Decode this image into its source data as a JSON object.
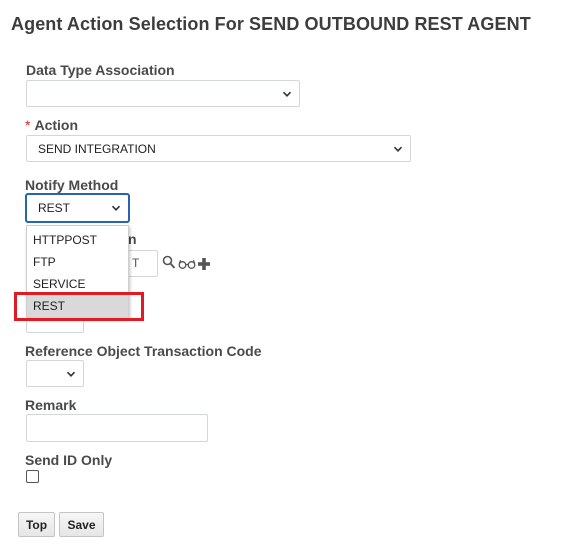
{
  "page": {
    "title": "Agent Action Selection For SEND OUTBOUND REST AGENT"
  },
  "fields": {
    "data_type_association": {
      "label": "Data Type Association",
      "value": ""
    },
    "action": {
      "required_marker": "*",
      "label": "Action",
      "value": "SEND INTEGRATION"
    },
    "notify_method": {
      "label": "Notify Method",
      "value": "REST",
      "options": [
        "HTTPPOST",
        "FTP",
        "SERVICE",
        "REST"
      ],
      "selected_index": 3
    },
    "hidden_field": {
      "label_fragment": "n",
      "value_fragment": "T"
    },
    "reference_object_transaction_code": {
      "label": "Reference Object Transaction Code",
      "value": ""
    },
    "remark": {
      "label": "Remark",
      "value": ""
    },
    "send_id_only": {
      "label": "Send ID Only",
      "checked": false
    }
  },
  "buttons": {
    "top": "Top",
    "save": "Save"
  },
  "colors": {
    "highlight": "#e01b24",
    "focus_border": "#2563b4",
    "selected_option_bg": "#d9d9d9"
  },
  "icons": {
    "lookup": "magnifier-icon",
    "view": "glasses-icon",
    "add": "plus-icon",
    "select_arrow": "chevron-down-icon"
  }
}
